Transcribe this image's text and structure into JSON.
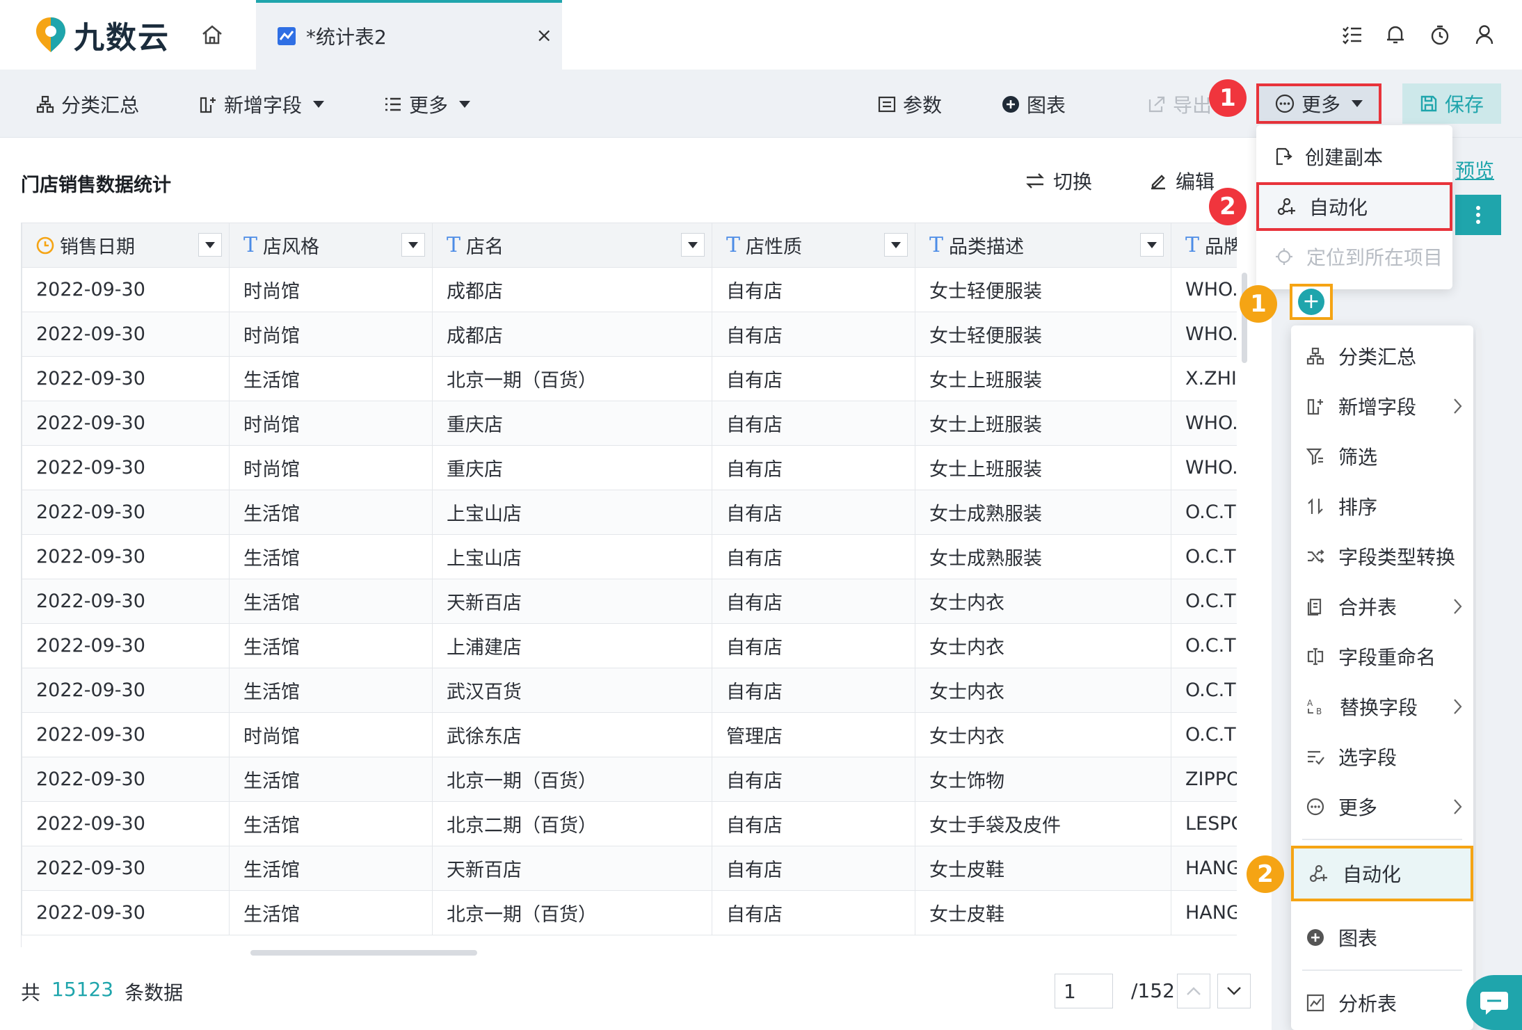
{
  "app": {
    "logo_text": "九数云"
  },
  "tabs": {
    "active_label": "*统计表2",
    "close_glyph": "×"
  },
  "toolbar": {
    "group": "分类汇总",
    "add_field": "新增字段",
    "more_left": "更多",
    "params": "参数",
    "chart": "图表",
    "export": "导出",
    "more_right": "更多",
    "save": "保存"
  },
  "badges": {
    "b1": "1",
    "b2": "2",
    "b3": "1",
    "b4": "2"
  },
  "panel": {
    "title": "门店销售数据统计",
    "switch": "切换",
    "edit": "编辑",
    "preview": "预览"
  },
  "more_menu": {
    "copy": "创建副本",
    "automation": "自动化",
    "locate": "定位到所在项目"
  },
  "table": {
    "headers": [
      "销售日期",
      "店风格",
      "店名",
      "店性质",
      "品类描述",
      "品牌"
    ],
    "rows": [
      [
        "2022-09-30",
        "时尚馆",
        "成都店",
        "自有店",
        "女士轻便服装",
        "WHO.A.U"
      ],
      [
        "2022-09-30",
        "时尚馆",
        "成都店",
        "自有店",
        "女士轻便服装",
        "WHO.A.U"
      ],
      [
        "2022-09-30",
        "生活馆",
        "北京一期（百货）",
        "自有店",
        "女士上班服装",
        "X.ZHILE"
      ],
      [
        "2022-09-30",
        "时尚馆",
        "重庆店",
        "自有店",
        "女士上班服装",
        "WHO.A.U"
      ],
      [
        "2022-09-30",
        "时尚馆",
        "重庆店",
        "自有店",
        "女士上班服装",
        "WHO.A.U"
      ],
      [
        "2022-09-30",
        "生活馆",
        "上宝山店",
        "自有店",
        "女士成熟服装",
        "O.C.T"
      ],
      [
        "2022-09-30",
        "生活馆",
        "上宝山店",
        "自有店",
        "女士成熟服装",
        "O.C.T"
      ],
      [
        "2022-09-30",
        "生活馆",
        "天新百店",
        "自有店",
        "女士内衣",
        "O.C.T"
      ],
      [
        "2022-09-30",
        "生活馆",
        "上浦建店",
        "自有店",
        "女士内衣",
        "O.C.T"
      ],
      [
        "2022-09-30",
        "生活馆",
        "武汉百货",
        "自有店",
        "女士内衣",
        "O.C.T"
      ],
      [
        "2022-09-30",
        "时尚馆",
        "武徐东店",
        "管理店",
        "女士内衣",
        "O.C.T"
      ],
      [
        "2022-09-30",
        "生活馆",
        "北京一期（百货）",
        "自有店",
        "女士饰物",
        "ZIPPO"
      ],
      [
        "2022-09-30",
        "生活馆",
        "北京二期（百货）",
        "自有店",
        "女士手袋及皮件",
        "LESPORTSAC"
      ],
      [
        "2022-09-30",
        "生活馆",
        "天新百店",
        "自有店",
        "女士皮鞋",
        "HANG TEN"
      ],
      [
        "2022-09-30",
        "生活馆",
        "北京一期（百货）",
        "自有店",
        "女士皮鞋",
        "HANG TEN"
      ]
    ]
  },
  "footer": {
    "prefix": "共",
    "count": "15123",
    "suffix": "条数据",
    "page": "1",
    "total": "/152"
  },
  "side_menu": {
    "group": "分类汇总",
    "add_field": "新增字段",
    "filter": "筛选",
    "sort": "排序",
    "convert": "字段类型转换",
    "merge": "合并表",
    "rename": "字段重命名",
    "replace": "替换字段",
    "select": "选字段",
    "more": "更多",
    "automation": "自动化",
    "chart": "图表",
    "analysis": "分析表"
  },
  "colors": {
    "accent": "#1fa5ac",
    "highlight_red": "#e8333b",
    "highlight_orange": "#f5a414"
  }
}
